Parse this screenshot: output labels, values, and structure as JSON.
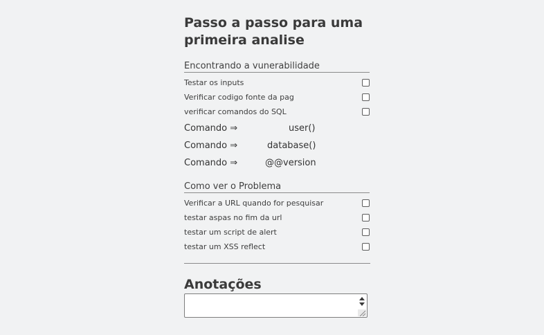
{
  "page": {
    "title_line1": "Passo a passo para uma",
    "title_line2": "primeira analise"
  },
  "section1": {
    "heading": "Encontrando a vunerabilidade",
    "items": [
      {
        "label": "Testar os inputs",
        "checked": false
      },
      {
        "label": "Verificar codigo fonte da pag",
        "checked": false
      },
      {
        "label": "verificar comandos do SQL",
        "checked": false
      }
    ],
    "commands": [
      {
        "label": "Comando",
        "arrow": "⇒",
        "value": "user()"
      },
      {
        "label": "Comando",
        "arrow": "⇒",
        "value": "database()"
      },
      {
        "label": "Comando",
        "arrow": "⇒",
        "value": "@@version"
      }
    ]
  },
  "section2": {
    "heading": "Como ver o Problema",
    "items": [
      {
        "label": "Verificar a URL quando for pesquisar",
        "checked": false
      },
      {
        "label": "testar aspas no fim da url",
        "checked": false
      },
      {
        "label": "testar um script de alert",
        "checked": false
      },
      {
        "label": "testar um XSS reflect",
        "checked": false
      }
    ]
  },
  "notes": {
    "title": "Anotações",
    "value": ""
  },
  "icons": {
    "spinner_up": "triangle-up-icon",
    "spinner_down": "triangle-down-icon",
    "resize": "resize-grip-icon"
  }
}
